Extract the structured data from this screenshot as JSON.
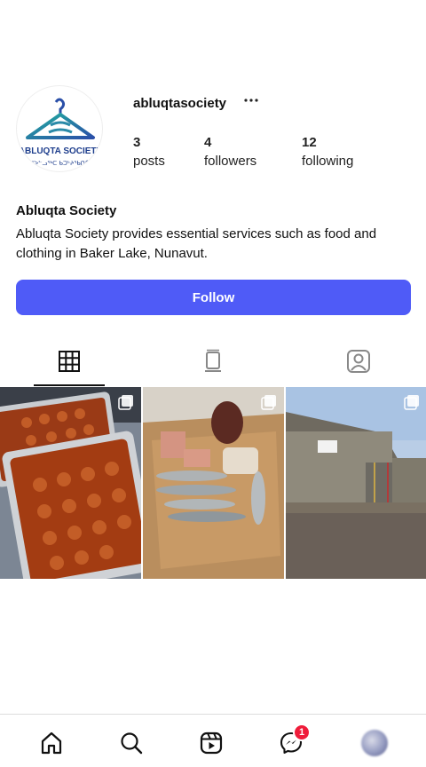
{
  "profile": {
    "username": "abluqtasociety",
    "more_icon": "ellipsis-icon",
    "logo_text": "ABLUQTA SOCIETY",
    "logo_syllabics": "ᐊᐳᓪᓗᖅᑕ ᑲᑐᔾᔨᖃᑎᒌᑦ",
    "stats": [
      {
        "value": "3",
        "label": "posts"
      },
      {
        "value": "4",
        "label": "followers"
      },
      {
        "value": "12",
        "label": "following"
      }
    ],
    "display_name": "Abluqta Society",
    "bio": "Abluqta Society provides essential services such as food and clothing in Baker Lake, Nunavut.",
    "follow_label": "Follow",
    "accent_color": "#4f5bf7"
  },
  "tabs": [
    {
      "name": "grid-icon",
      "active": true
    },
    {
      "name": "reels-icon",
      "active": false
    },
    {
      "name": "tagged-icon",
      "active": false
    }
  ],
  "posts": [
    {
      "subject": "trays of food",
      "multi": true
    },
    {
      "subject": "fish and meat",
      "multi": true
    },
    {
      "subject": "building exterior",
      "multi": true
    }
  ],
  "nav": {
    "items": [
      "home-icon",
      "search-icon",
      "reels-icon",
      "messenger-icon",
      "profile-avatar"
    ],
    "messenger_badge": "1",
    "badge_color": "#ef1c3a"
  }
}
